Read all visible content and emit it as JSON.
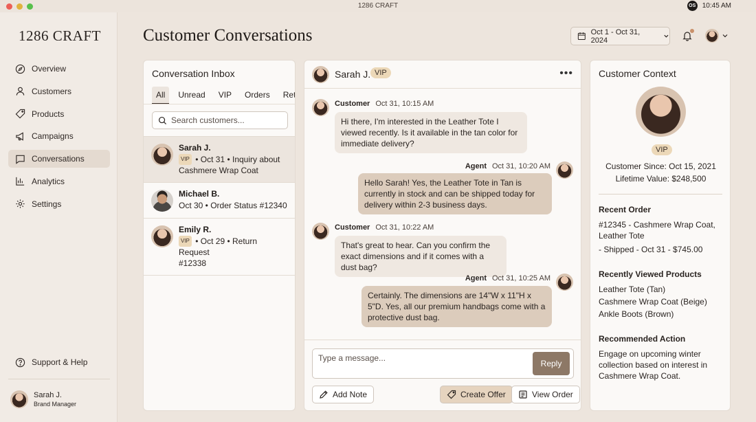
{
  "menubar": {
    "title": "1286 CRAFT",
    "os_badge": "OS",
    "time": "10:45 AM"
  },
  "sidebar": {
    "brand": "1286 CRAFT",
    "items": [
      {
        "label": "Overview",
        "icon": "compass-icon"
      },
      {
        "label": "Customers",
        "icon": "user-icon"
      },
      {
        "label": "Products",
        "icon": "tag-icon"
      },
      {
        "label": "Campaigns",
        "icon": "megaphone-icon"
      },
      {
        "label": "Conversations",
        "icon": "chat-icon",
        "active": true
      },
      {
        "label": "Analytics",
        "icon": "bar-chart-icon"
      },
      {
        "label": "Settings",
        "icon": "gear-icon"
      }
    ],
    "help_label": "Support & Help",
    "user": {
      "name": "Sarah J.",
      "role": "Brand Manager"
    }
  },
  "header": {
    "title": "Customer Conversations",
    "date_range": "Oct 1 - Oct 31, 2024"
  },
  "inbox": {
    "title": "Conversation Inbox",
    "tabs": [
      "All",
      "Unread",
      "VIP",
      "Orders",
      "Returns"
    ],
    "search_placeholder": "Search customers...",
    "conversations": [
      {
        "name": "Sarah J.",
        "vip": "VIP",
        "line1": " • Oct 31 • Inquiry about",
        "line2": "Cashmere Wrap Coat"
      },
      {
        "name": "Michael B.",
        "vip": "",
        "line1": "Oct 30 • Order Status #12340",
        "line2": ""
      },
      {
        "name": "Emily R.",
        "vip": "VIP",
        "line1": " • Oct 29 • Return Request",
        "line2": "#12338"
      }
    ]
  },
  "chat": {
    "name": "Sarah J.",
    "vip": "VIP",
    "menu": "•••",
    "messages": [
      {
        "sender": "Customer",
        "time": "Oct 31, 10:15 AM",
        "text": "Hi there, I'm interested in the Leather Tote I viewed recently. Is it available in the tan color for immediate delivery?"
      },
      {
        "sender": "Agent",
        "time": "Oct 31, 10:20 AM",
        "text": "Hello Sarah! Yes, the Leather Tote in Tan is currently in stock and can be shipped today for delivery within 2-3 business days."
      },
      {
        "sender": "Customer",
        "time": "Oct 31, 10:22 AM",
        "text": "That's great to hear. Can you confirm the exact dimensions and if it comes with a dust bag?"
      },
      {
        "sender": "Agent",
        "time": "Oct 31, 10:25 AM",
        "text": "Certainly. The dimensions are 14\"W x 11\"H x 5\"D. Yes, all our premium handbags come with a protective dust bag."
      }
    ],
    "compose_placeholder": "Type a message...",
    "reply_label": "Reply",
    "add_note_label": "Add Note",
    "create_offer_label": "Create Offer",
    "view_order_label": "View Order"
  },
  "context": {
    "title": "Customer Context",
    "vip": "VIP",
    "since": "Customer Since: Oct 15, 2021",
    "lifetime": "Lifetime Value: $248,500",
    "recent_order_heading": "Recent Order",
    "recent_order_line1": "#12345 - Cashmere Wrap Coat, Leather Tote",
    "recent_order_line2": "- Shipped - Oct 31 - $745.00",
    "viewed_heading": "Recently Viewed Products",
    "viewed": [
      "Leather Tote (Tan)",
      "Cashmere Wrap Coat (Beige)",
      "Ankle Boots (Brown)"
    ],
    "action_heading": "Recommended Action",
    "action_text": "Engage on upcoming winter collection based on interest in Cashmere Wrap Coat."
  },
  "colors": {
    "accent": "#8d7866",
    "vip_badge": "#ecd8b8",
    "agent_bubble": "#dcccbc",
    "customer_bubble": "#efe8e1"
  }
}
